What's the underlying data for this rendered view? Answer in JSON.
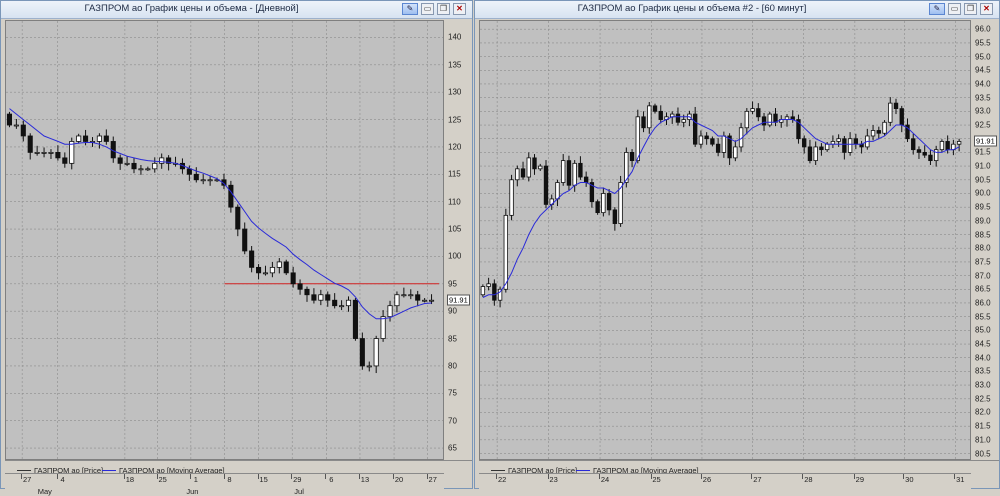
{
  "windows": [
    {
      "title": "ГАЗПРОМ ао График цены и объема - [Дневной]",
      "buttons": {
        "pin": "✎",
        "minimize": "▭",
        "restore": "❐",
        "close": "✕"
      },
      "legend": {
        "price": "ГАЗПРОМ ао [Price]",
        "ma": "ГАЗПРОМ ао [Moving Average]"
      },
      "price_tag": "91.91",
      "y_ticks": [
        "140",
        "135",
        "130",
        "125",
        "120",
        "115",
        "110",
        "105",
        "100",
        "95",
        "90",
        "85",
        "80",
        "75",
        "70",
        "65"
      ],
      "x_ticks": [
        "27",
        "4",
        "18",
        "25",
        "1",
        "8",
        "15",
        "29",
        "6",
        "13",
        "20",
        "27"
      ],
      "months": [
        "May",
        "Jun",
        "Jul"
      ]
    },
    {
      "title": "ГАЗПРОМ ао График цены и объема #2 - [60 минут]",
      "buttons": {
        "pin": "✎",
        "minimize": "▭",
        "restore": "❐",
        "close": "✕"
      },
      "legend": {
        "price": "ГАЗПРОМ ао [Price]",
        "ma": "ГАЗПРОМ ао [Moving Average]"
      },
      "price_tag": "91.91",
      "y_ticks": [
        "96.0",
        "95.5",
        "95.0",
        "94.5",
        "94.0",
        "93.5",
        "93.0",
        "92.5",
        "92.0",
        "91.5",
        "91.0",
        "90.5",
        "90.0",
        "89.5",
        "89.0",
        "88.5",
        "88.0",
        "87.5",
        "87.0",
        "86.5",
        "86.0",
        "85.5",
        "85.0",
        "84.5",
        "84.0",
        "83.5",
        "83.0",
        "82.5",
        "82.0",
        "81.5",
        "81.0",
        "80.5"
      ],
      "x_ticks": [
        "22",
        "23",
        "24",
        "25",
        "26",
        "27",
        "28",
        "29",
        "30",
        "31"
      ]
    }
  ],
  "chart_data": [
    {
      "type": "candlestick",
      "title": "ГАЗПРОМ ао График цены и объема - [Дневной]",
      "series": [
        {
          "name": "ГАЗПРОМ ао [Price]",
          "color": "#000000"
        },
        {
          "name": "ГАЗПРОМ ао [Moving Average]",
          "color": "#2a2ad8"
        }
      ],
      "ylim": [
        63,
        143
      ],
      "reference_line": {
        "value": 95,
        "color": "#d02020"
      },
      "close": [
        124,
        124,
        122,
        119,
        119,
        119,
        119,
        118,
        117,
        121,
        122,
        121,
        121,
        122,
        121,
        118,
        117,
        117,
        116,
        116,
        116,
        117,
        118,
        117,
        117,
        116,
        115,
        114,
        114,
        114,
        114,
        113,
        109,
        105,
        101,
        98,
        97,
        97,
        98,
        99,
        97,
        95,
        94,
        93,
        92,
        93,
        92,
        91,
        91,
        92,
        85,
        80,
        80,
        85,
        89,
        91,
        93,
        93,
        93,
        92,
        92,
        92
      ],
      "ma": [
        127,
        126,
        125,
        124,
        123,
        122,
        121.5,
        121,
        120.5,
        120.5,
        120.7,
        120.8,
        120.8,
        120.5,
        120,
        119.3,
        118.8,
        118.3,
        118,
        117.7,
        117.5,
        117.4,
        117.3,
        117.2,
        117,
        116.6,
        116.1,
        115.6,
        115.2,
        114.7,
        114.2,
        113.3,
        111.8,
        110,
        108.2,
        106.4,
        105.2,
        104.2,
        103.3,
        102.5,
        101.7,
        100.4,
        99.4,
        98.5,
        97.5,
        96.7,
        95.9,
        95.1,
        94.6,
        93.9,
        92.6,
        90.8,
        89.5,
        88.6,
        88.6,
        88.8,
        89.4,
        90,
        90.6,
        91,
        91.4,
        91.5
      ]
    },
    {
      "type": "candlestick",
      "title": "ГАЗПРОМ ао График цены и объема #2 - [60 минут]",
      "series": [
        {
          "name": "ГАЗПРОМ ао [Price]",
          "color": "#000000"
        },
        {
          "name": "ГАЗПРОМ ао [Moving Average]",
          "color": "#2a2ad8"
        }
      ],
      "ylim": [
        80.3,
        96.3
      ],
      "close": [
        86.6,
        86.7,
        86.1,
        86.5,
        89.2,
        90.5,
        90.9,
        90.6,
        91.3,
        90.9,
        91.0,
        89.6,
        89.8,
        90.4,
        91.2,
        90.3,
        91.1,
        90.6,
        90.4,
        89.7,
        89.3,
        90.0,
        89.4,
        88.9,
        90.4,
        91.5,
        91.2,
        92.8,
        92.4,
        93.2,
        93.0,
        92.7,
        92.8,
        92.9,
        92.6,
        92.7,
        92.9,
        91.8,
        92.1,
        92.0,
        91.8,
        91.5,
        92.1,
        91.3,
        91.7,
        92.4,
        93.0,
        93.1,
        92.8,
        92.5,
        92.9,
        92.6,
        92.7,
        92.8,
        92.7,
        92.0,
        91.7,
        91.2,
        91.7,
        91.6,
        91.8,
        91.9,
        92.0,
        91.5,
        92.0,
        91.8,
        91.7,
        92.1,
        92.3,
        92.2,
        92.6,
        93.3,
        93.1,
        92.5,
        92.0,
        91.6,
        91.5,
        91.4,
        91.2,
        91.6,
        91.9,
        91.6,
        91.8,
        91.9
      ],
      "ma": [
        86.2,
        86.3,
        86.3,
        86.4,
        86.7,
        87.1,
        87.6,
        88,
        88.5,
        88.9,
        89.2,
        89.4,
        89.6,
        89.8,
        90,
        90.1,
        90.3,
        90.4,
        90.4,
        90.3,
        90.2,
        90.2,
        90.1,
        90,
        90.2,
        90.5,
        90.8,
        91.3,
        91.7,
        92.1,
        92.4,
        92.6,
        92.7,
        92.8,
        92.8,
        92.8,
        92.8,
        92.6,
        92.5,
        92.4,
        92.3,
        92.1,
        92.1,
        92,
        91.9,
        92,
        92.2,
        92.4,
        92.5,
        92.6,
        92.6,
        92.6,
        92.7,
        92.7,
        92.7,
        92.6,
        92.4,
        92.2,
        92,
        91.9,
        91.8,
        91.8,
        91.8,
        91.8,
        91.8,
        91.8,
        91.8,
        91.9,
        91.9,
        92,
        92.1,
        92.3,
        92.5,
        92.5,
        92.4,
        92.2,
        92,
        91.8,
        91.6,
        91.5,
        91.5,
        91.6,
        91.6,
        91.7
      ]
    }
  ]
}
